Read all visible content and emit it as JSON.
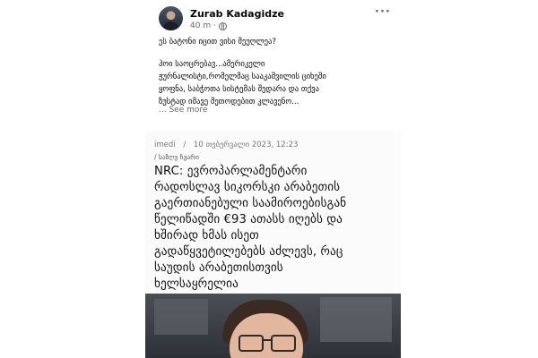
{
  "post": {
    "author": "Zurab Kadagidze",
    "time": "40 m",
    "dot": "·",
    "more": "···",
    "question": "ეს ბატონი იცით ვისი მეუღლეა?",
    "body_lines": [
      "ჰოი საოცრებავ...ამერიკელი",
      "ჟურნალისტი,რომელმაც სააკაშვილის ციხეში",
      "ყოფნა, საბჭოთა სისტემას შედარა და თქვა",
      "ზუსტად იმავე მეთოდებით კლავენო..."
    ],
    "see_more": "... See more"
  },
  "article": {
    "source": "imedi",
    "separator": "/",
    "date": "10 თებერვალი 2023, 12:23",
    "category": "საზღვ ჩვარი",
    "headline_lines": [
      "NRC: ევროპარლამენტარი",
      "რადოსლავ სიკორსკი არაბეთის",
      "გაერთიანებული საამიროებისგან",
      "წელიწადში €93 ათასს იღებს და",
      "ხშირად ხმას ისეთ",
      "გადაწყვეტილებებს აძლევს, რაც",
      "საუდის არაბეთისთვის",
      "ხელსაყრელია"
    ]
  },
  "colors": {
    "name_text": "#050505",
    "meta_text": "#65676b",
    "panel_bg": "#fbfbfb"
  },
  "icons": [
    "avatar-photo",
    "globe-icon",
    "more-options-icon"
  ]
}
